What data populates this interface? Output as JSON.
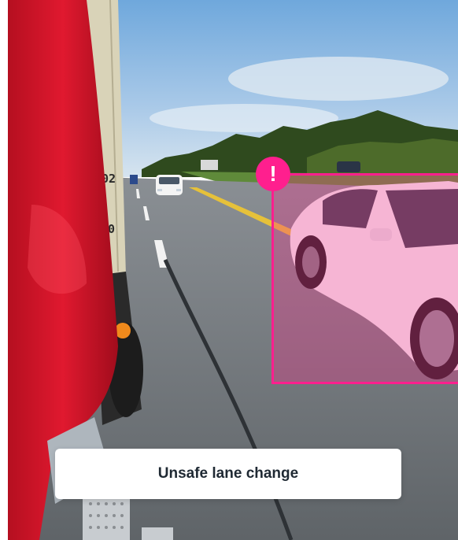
{
  "alert": {
    "badge": "!",
    "color": "#ff1f8e",
    "icon": "exclamation-icon"
  },
  "caption": {
    "text": "Unsafe lane change"
  },
  "trailer": {
    "number_upper": "202",
    "number_lower": "20"
  }
}
